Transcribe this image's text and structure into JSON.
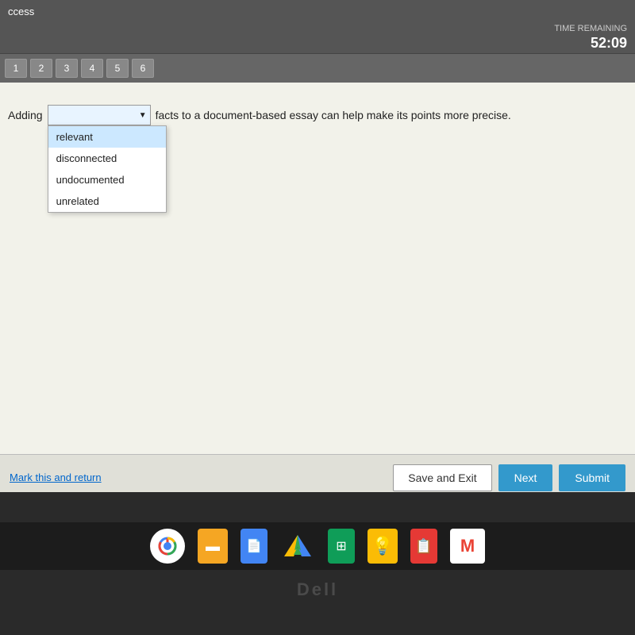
{
  "title_bar": {
    "text": "ccess"
  },
  "timer": {
    "label": "TIME REMAINING",
    "value": "52:09"
  },
  "nav": {
    "buttons": [
      "1",
      "2",
      "3",
      "4",
      "5",
      "6"
    ]
  },
  "question": {
    "prefix": "Adding",
    "suffix": "facts to a document-based essay can help make its points more precise.",
    "dropdown_placeholder": ""
  },
  "dropdown": {
    "options": [
      {
        "value": "relevant",
        "label": "relevant"
      },
      {
        "value": "disconnected",
        "label": "disconnected"
      },
      {
        "value": "undocumented",
        "label": "undocumented"
      },
      {
        "value": "unrelated",
        "label": "unrelated"
      }
    ]
  },
  "actions": {
    "mark_return": "Mark this and return",
    "save_exit": "Save and Exit",
    "next": "Next",
    "submit": "Submit"
  },
  "taskbar": {
    "icons": [
      {
        "name": "chrome",
        "symbol": "🌐",
        "bg": "#fff"
      },
      {
        "name": "slides",
        "symbol": "🟧",
        "bg": "#f5a623"
      },
      {
        "name": "docs",
        "symbol": "📄",
        "bg": "#4285f4"
      },
      {
        "name": "drive",
        "symbol": "▲",
        "bg": "#34a853"
      },
      {
        "name": "sheets",
        "symbol": "▦",
        "bg": "#0f9d58"
      },
      {
        "name": "keep",
        "symbol": "💡",
        "bg": "#fbbc05"
      },
      {
        "name": "forms",
        "symbol": "📋",
        "bg": "#e53935"
      },
      {
        "name": "gmail",
        "symbol": "M",
        "bg": "#fff"
      }
    ]
  },
  "dell_logo": "Dell"
}
